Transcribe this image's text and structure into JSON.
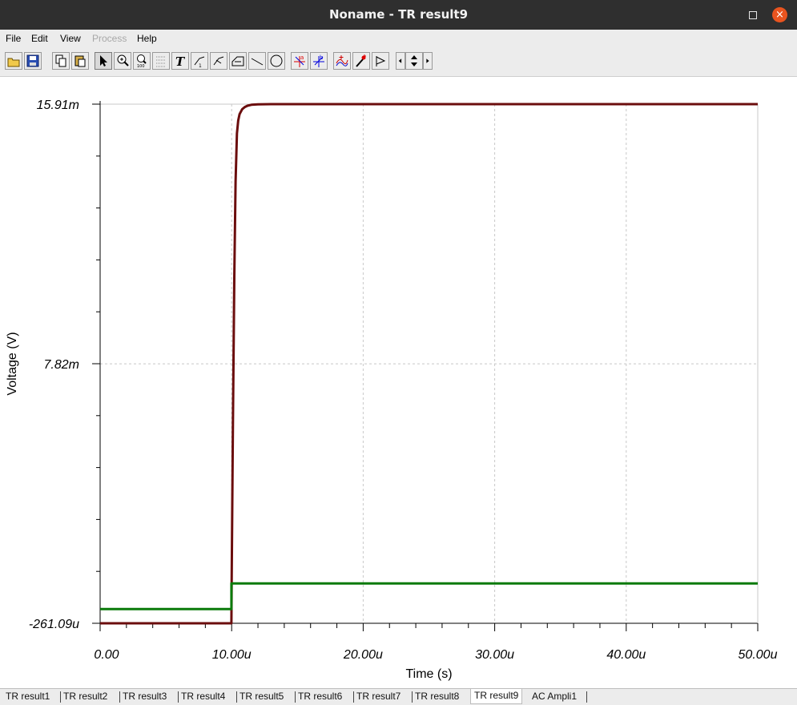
{
  "window": {
    "title": "Noname - TR result9",
    "close_glyph": "×"
  },
  "menu": [
    {
      "label": "File",
      "enabled": true
    },
    {
      "label": "Edit",
      "enabled": true
    },
    {
      "label": "View",
      "enabled": true
    },
    {
      "label": "Process",
      "enabled": false
    },
    {
      "label": "Help",
      "enabled": true
    }
  ],
  "toolbar": [
    "open-folder-icon",
    "save-icon",
    "copy-icon",
    "paste-icon",
    "select-arrow-icon",
    "zoom-in-icon",
    "zoom-100-icon",
    "grid-icon",
    "text-icon",
    "marker-1-icon",
    "marker-2-icon",
    "marker-3-icon",
    "line-icon",
    "circle-icon",
    "cursor-a-icon",
    "cursor-b-icon",
    "curves-icon",
    "probe-icon",
    "flag-icon",
    "left-arrow-icon",
    "up-down-arrow-icon",
    "right-arrow-icon"
  ],
  "chart_data": {
    "type": "line",
    "xlabel": "Time (s)",
    "ylabel": "Voltage (V)",
    "xlim": [
      0,
      50
    ],
    "ylim": [
      -0.26109,
      15.91
    ],
    "x_unit_note": "microseconds (u); y in millivolts (m)",
    "x_ticks": [
      "0.00",
      "10.00u",
      "20.00u",
      "30.00u",
      "40.00u",
      "50.00u"
    ],
    "y_ticks": [
      "-261.09u",
      "7.82m",
      "15.91m"
    ],
    "grid": true,
    "series": [
      {
        "color": "#6b0d0d",
        "x": [
          0,
          9.98,
          10.0,
          10.1,
          10.2,
          10.3,
          10.4,
          10.5,
          10.6,
          10.8,
          11.0,
          11.2,
          11.5,
          12.0,
          13.0,
          50.0
        ],
        "y": [
          -0.26109,
          -0.26109,
          1.0,
          6.0,
          10.5,
          13.5,
          15.0,
          15.4,
          15.6,
          15.75,
          15.82,
          15.86,
          15.89,
          15.905,
          15.91,
          15.91
        ]
      },
      {
        "color": "#0a7a0a",
        "x": [
          0,
          9.98,
          9.98,
          50.0
        ],
        "y": [
          0.18,
          0.18,
          0.98,
          0.98
        ]
      }
    ]
  },
  "tabs": [
    {
      "label": "TR result1",
      "active": false
    },
    {
      "label": "TR result2",
      "active": false
    },
    {
      "label": "TR result3",
      "active": false
    },
    {
      "label": "TR result4",
      "active": false
    },
    {
      "label": "TR result5",
      "active": false
    },
    {
      "label": "TR result6",
      "active": false
    },
    {
      "label": "TR result7",
      "active": false
    },
    {
      "label": "TR result8",
      "active": false
    },
    {
      "label": "TR result9",
      "active": true
    },
    {
      "label": "AC Ampli1",
      "active": false
    }
  ]
}
